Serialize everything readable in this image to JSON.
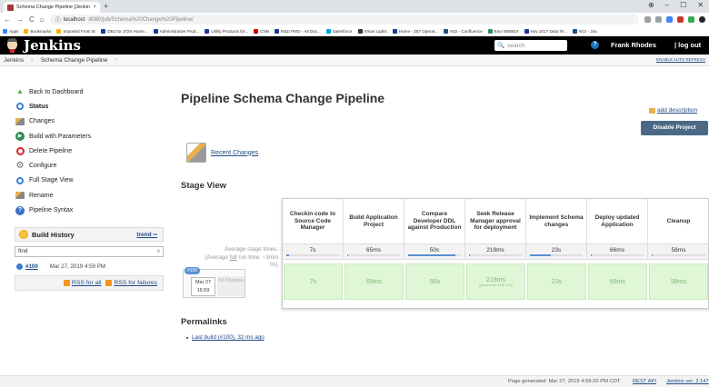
{
  "browser": {
    "tab_title": "Schema Change Pipeline [Jenkins]",
    "tab_close": "×",
    "new_tab": "+",
    "window_controls": [
      "⊕",
      "–",
      "☐",
      "✕"
    ],
    "nav_buttons": [
      "←",
      "→",
      "C",
      "⌂"
    ],
    "url_host": "localhost",
    "url_rest": ":8080/job/Schema%20Change%20Pipeline/",
    "bookmarks": [
      {
        "label": "Apps",
        "color": "#4285f4"
      },
      {
        "label": "Bookmarks",
        "color": "#f4b400"
      },
      {
        "label": "Imported From IE",
        "color": "#f4b400"
      },
      {
        "label": "DB2 for z/OS Home...",
        "color": "#1a3a8f"
      },
      {
        "label": "Administrative Prod...",
        "color": "#1a3a8f"
      },
      {
        "label": "Utility Products for...",
        "color": "#1a3a8f"
      },
      {
        "label": "CNN",
        "color": "#cc0000"
      },
      {
        "label": "R&D PMO - All Doc...",
        "color": "#1a3a8f"
      },
      {
        "label": "Salesforce",
        "color": "#00a1e0"
      },
      {
        "label": "Xmas Lights",
        "color": "#333333"
      },
      {
        "label": "Home - Z57 Operat...",
        "color": "#1a3a8f"
      },
      {
        "label": "NGI - Confluence",
        "color": "#205081"
      },
      {
        "label": "Envi WEBEX",
        "color": "#2e8b57"
      },
      {
        "label": "Nov 2017 Data Te...",
        "color": "#1a3a8f"
      },
      {
        "label": "NGI - Jira",
        "color": "#205081"
      }
    ]
  },
  "header": {
    "logo": "Jenkins",
    "search_placeholder": "search",
    "help": "?",
    "user": "Frank Rhodes",
    "logout": "| log out"
  },
  "breadcrumb": {
    "items": [
      "Jenkins",
      "Schema Change Pipeline"
    ],
    "sep": "»",
    "auto_refresh": "ENABLE AUTO REFRESH"
  },
  "sidebar": {
    "items": [
      {
        "label": "Back to Dashboard",
        "icon": "up-arrow-icon"
      },
      {
        "label": "Status",
        "icon": "magnifier-icon"
      },
      {
        "label": "Changes",
        "icon": "notepad-icon"
      },
      {
        "label": "Build with Parameters",
        "icon": "play-icon"
      },
      {
        "label": "Delete Pipeline",
        "icon": "no-entry-icon"
      },
      {
        "label": "Configure",
        "icon": "gear-icon"
      },
      {
        "label": "Full Stage View",
        "icon": "magnifier-icon"
      },
      {
        "label": "Rename",
        "icon": "notepad-icon"
      },
      {
        "label": "Pipeline Syntax",
        "icon": "help-icon"
      }
    ],
    "build_history": {
      "title": "Build History",
      "trend": "trend ═",
      "find_value": "find",
      "find_clear": "x",
      "builds": [
        {
          "num": "#100",
          "date": "Mar 27, 2019 4:59 PM"
        }
      ],
      "rss_all": "RSS for all",
      "rss_failures": "RSS for failures"
    }
  },
  "main": {
    "title": "Pipeline Schema Change Pipeline",
    "add_description": "add description",
    "disable_button": "Disable Project",
    "recent_changes": "Recent Changes",
    "stage_view_title": "Stage View",
    "avg_label_1": "Average stage times:",
    "avg_label_2_pre": "(Average ",
    "avg_label_2_link": "full",
    "avg_label_2_post": " run time: ~3min",
    "avg_label_3": "0s)",
    "stages": [
      {
        "name": "Checkin code to Source Code Manager",
        "avg": "7s",
        "avg_fill": 0.05,
        "run": "7s",
        "run_sub": ""
      },
      {
        "name": "Build Application Project",
        "avg": "65ms",
        "avg_fill": 0.01,
        "run": "65ms",
        "run_sub": ""
      },
      {
        "name": "Compare Developer DDL against Production",
        "avg": "50s",
        "avg_fill": 0.9,
        "run": "50s",
        "run_sub": ""
      },
      {
        "name": "Seek Release Manager approval for deployment",
        "avg": "219ms",
        "avg_fill": 0.02,
        "run": "219ms",
        "run_sub": "(paused for 1min 37s)"
      },
      {
        "name": "Implement Schema changes",
        "avg": "23s",
        "avg_fill": 0.4,
        "run": "23s",
        "run_sub": ""
      },
      {
        "name": "Deploy updated Application",
        "avg": "66ms",
        "avg_fill": 0.01,
        "run": "66ms",
        "run_sub": ""
      },
      {
        "name": "Cleanup",
        "avg": "58ms",
        "avg_fill": 0.01,
        "run": "58ms",
        "run_sub": ""
      }
    ],
    "run": {
      "num": "#100",
      "date": "Mar 27",
      "time": "16:59",
      "changes": "No Changes"
    },
    "permalinks_title": "Permalinks",
    "permalinks": [
      "Last build (#100), 32 ms ago"
    ]
  },
  "footer": {
    "generated": "Page generated: Mar 27, 2019 4:59:20 PM CDT",
    "rest_api": "REST API",
    "version": "Jenkins ver. 2.147"
  }
}
